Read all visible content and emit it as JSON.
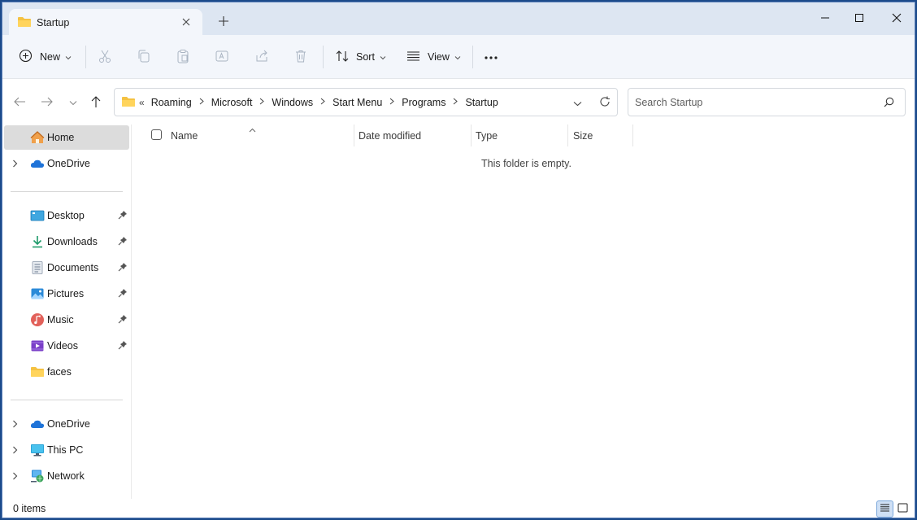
{
  "window": {
    "tab_title": "Startup",
    "new_tab_symbol": "+",
    "controls": [
      "minimize-icon",
      "maximize-icon",
      "close-icon"
    ]
  },
  "toolbar": {
    "new_label": "New",
    "sort_label": "Sort",
    "view_label": "View",
    "more_symbol": "···",
    "actions": [
      "cut-icon",
      "copy-icon",
      "paste-icon",
      "rename-icon",
      "share-icon",
      "delete-icon"
    ]
  },
  "address": {
    "overflow": "«",
    "crumbs": [
      "Roaming",
      "Microsoft",
      "Windows",
      "Start Menu",
      "Programs",
      "Startup"
    ]
  },
  "search": {
    "placeholder": "Search Startup"
  },
  "sidebar": {
    "top": [
      {
        "label": "Home",
        "icon": "home-icon",
        "selected": true
      },
      {
        "label": "OneDrive",
        "icon": "cloud-icon",
        "expandable": true
      }
    ],
    "quick_access": [
      {
        "label": "Desktop",
        "icon": "desktop-icon",
        "pinned": true
      },
      {
        "label": "Downloads",
        "icon": "download-icon",
        "pinned": true
      },
      {
        "label": "Documents",
        "icon": "document-icon",
        "pinned": true
      },
      {
        "label": "Pictures",
        "icon": "picture-icon",
        "pinned": true
      },
      {
        "label": "Music",
        "icon": "music-icon",
        "pinned": true
      },
      {
        "label": "Videos",
        "icon": "video-icon",
        "pinned": true
      },
      {
        "label": "faces",
        "icon": "folder-icon",
        "pinned": false
      }
    ],
    "bottom": [
      {
        "label": "OneDrive",
        "icon": "cloud-icon"
      },
      {
        "label": "This PC",
        "icon": "pc-icon"
      },
      {
        "label": "Network",
        "icon": "network-icon"
      }
    ]
  },
  "columns": {
    "name": "Name",
    "date_modified": "Date modified",
    "type": "Type",
    "size": "Size"
  },
  "content": {
    "empty_message": "This folder is empty."
  },
  "status": {
    "items": "0 items"
  },
  "colors": {
    "accent": "#0067c0",
    "titlebar": "#dde6f2",
    "toolbar": "#f3f6fb",
    "selected": "#dcdcdc",
    "folder": "#f5c242"
  }
}
